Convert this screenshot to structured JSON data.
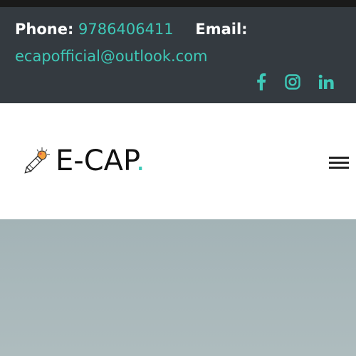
{
  "contact": {
    "phone_label": "Phone:",
    "phone_value": "9786406411",
    "email_label": "Email:",
    "email_value": "ecapofficial@outlook.com"
  },
  "social": [
    {
      "icon": "facebook-icon"
    },
    {
      "icon": "instagram-icon"
    },
    {
      "icon": "linkedin-icon"
    }
  ],
  "brand": {
    "name": "E-CAP",
    "dot": ".",
    "logo_icon": "pencil-lightbulb-icon"
  },
  "menu": {
    "icon": "hamburger-menu-icon"
  },
  "colors": {
    "accent": "#3ec9b8",
    "contact_bar_bg": "#343a40",
    "header_bg": "#ffffff",
    "hero_bg": "#a9b8bb"
  }
}
